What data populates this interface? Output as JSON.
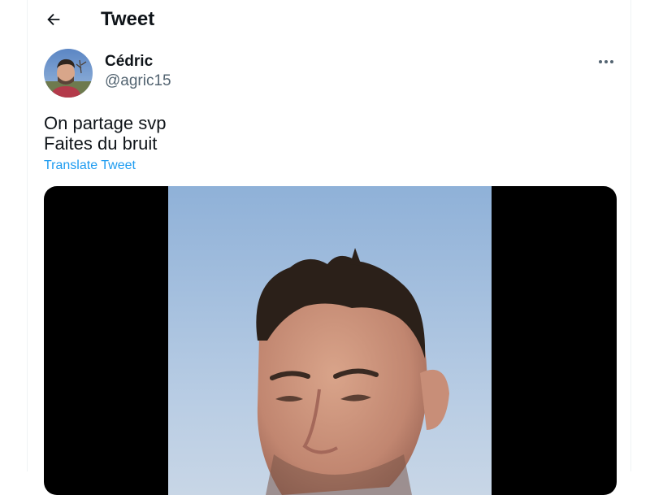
{
  "header": {
    "title": "Tweet",
    "back_icon": "arrow-left-icon"
  },
  "tweet": {
    "author": {
      "name": "Cédric",
      "handle": "@agric15",
      "avatar": "profile-photo"
    },
    "more_icon": "more-horizontal-icon",
    "text_lines": [
      "On partage svp",
      "Faites du bruit"
    ],
    "translate_label": "Translate Tweet",
    "media": {
      "type": "video",
      "description_icon": "video-thumbnail"
    }
  },
  "colors": {
    "text_primary": "#0f1419",
    "text_secondary": "#536471",
    "link": "#1d9bf0",
    "media_background": "#000000"
  }
}
